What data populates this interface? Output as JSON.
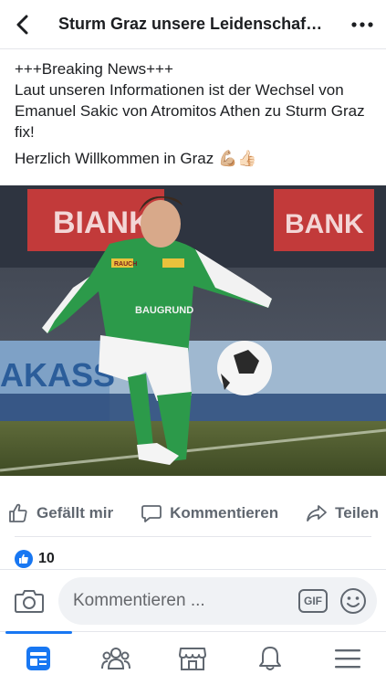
{
  "header": {
    "title": "Sturm Graz unsere Leidenschaf…",
    "back_icon": "chevron-left-icon",
    "more_icon": "more-horizontal-icon"
  },
  "post": {
    "line1": "+++Breaking News+++",
    "line2": " Laut unseren Informationen ist der Wechsel von Emanuel Sakic  von Atromitos Athen zu Sturm Graz fix!",
    "line3": "Herzlich Willkommen in Graz",
    "emoji_muscle": "💪🏼",
    "emoji_thumbs": "👍🏻"
  },
  "photo": {
    "banner_text_left": "BIANK",
    "banner_text_right": "BANK",
    "ad_text": "AKASS",
    "jersey_sponsor": "BAUGRUND",
    "jersey_brand": "RAUCH"
  },
  "actions": {
    "like_label": "Gefällt mir",
    "comment_label": "Kommentieren",
    "share_label": "Teilen"
  },
  "reactions": {
    "count": "10"
  },
  "comment": {
    "placeholder": "Kommentieren ...",
    "gif_label": "GIF"
  },
  "colors": {
    "accent": "#1877f2",
    "text": "#1c1e21",
    "muted": "#606770",
    "divider": "#e4e6eb",
    "input_bg": "#f0f2f5"
  },
  "tabs": [
    {
      "name": "news-feed",
      "icon": "news-feed-icon",
      "active": true
    },
    {
      "name": "groups",
      "icon": "groups-icon",
      "active": false
    },
    {
      "name": "marketplace",
      "icon": "marketplace-icon",
      "active": false
    },
    {
      "name": "notifications",
      "icon": "bell-icon",
      "active": false
    },
    {
      "name": "menu",
      "icon": "menu-icon",
      "active": false
    }
  ]
}
